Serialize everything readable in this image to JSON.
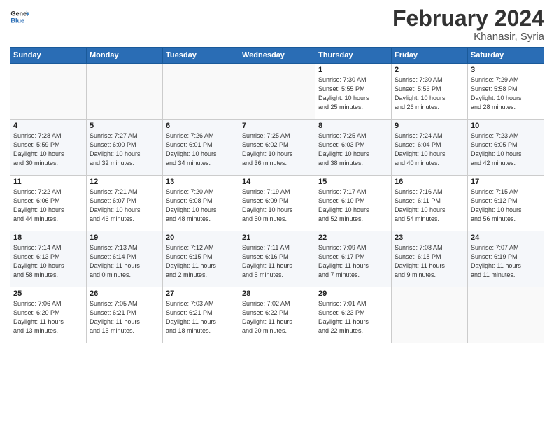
{
  "header": {
    "logo_line1": "General",
    "logo_line2": "Blue",
    "month": "February 2024",
    "location": "Khanasir, Syria"
  },
  "weekdays": [
    "Sunday",
    "Monday",
    "Tuesday",
    "Wednesday",
    "Thursday",
    "Friday",
    "Saturday"
  ],
  "weeks": [
    [
      {
        "num": "",
        "info": ""
      },
      {
        "num": "",
        "info": ""
      },
      {
        "num": "",
        "info": ""
      },
      {
        "num": "",
        "info": ""
      },
      {
        "num": "1",
        "info": "Sunrise: 7:30 AM\nSunset: 5:55 PM\nDaylight: 10 hours\nand 25 minutes."
      },
      {
        "num": "2",
        "info": "Sunrise: 7:30 AM\nSunset: 5:56 PM\nDaylight: 10 hours\nand 26 minutes."
      },
      {
        "num": "3",
        "info": "Sunrise: 7:29 AM\nSunset: 5:58 PM\nDaylight: 10 hours\nand 28 minutes."
      }
    ],
    [
      {
        "num": "4",
        "info": "Sunrise: 7:28 AM\nSunset: 5:59 PM\nDaylight: 10 hours\nand 30 minutes."
      },
      {
        "num": "5",
        "info": "Sunrise: 7:27 AM\nSunset: 6:00 PM\nDaylight: 10 hours\nand 32 minutes."
      },
      {
        "num": "6",
        "info": "Sunrise: 7:26 AM\nSunset: 6:01 PM\nDaylight: 10 hours\nand 34 minutes."
      },
      {
        "num": "7",
        "info": "Sunrise: 7:25 AM\nSunset: 6:02 PM\nDaylight: 10 hours\nand 36 minutes."
      },
      {
        "num": "8",
        "info": "Sunrise: 7:25 AM\nSunset: 6:03 PM\nDaylight: 10 hours\nand 38 minutes."
      },
      {
        "num": "9",
        "info": "Sunrise: 7:24 AM\nSunset: 6:04 PM\nDaylight: 10 hours\nand 40 minutes."
      },
      {
        "num": "10",
        "info": "Sunrise: 7:23 AM\nSunset: 6:05 PM\nDaylight: 10 hours\nand 42 minutes."
      }
    ],
    [
      {
        "num": "11",
        "info": "Sunrise: 7:22 AM\nSunset: 6:06 PM\nDaylight: 10 hours\nand 44 minutes."
      },
      {
        "num": "12",
        "info": "Sunrise: 7:21 AM\nSunset: 6:07 PM\nDaylight: 10 hours\nand 46 minutes."
      },
      {
        "num": "13",
        "info": "Sunrise: 7:20 AM\nSunset: 6:08 PM\nDaylight: 10 hours\nand 48 minutes."
      },
      {
        "num": "14",
        "info": "Sunrise: 7:19 AM\nSunset: 6:09 PM\nDaylight: 10 hours\nand 50 minutes."
      },
      {
        "num": "15",
        "info": "Sunrise: 7:17 AM\nSunset: 6:10 PM\nDaylight: 10 hours\nand 52 minutes."
      },
      {
        "num": "16",
        "info": "Sunrise: 7:16 AM\nSunset: 6:11 PM\nDaylight: 10 hours\nand 54 minutes."
      },
      {
        "num": "17",
        "info": "Sunrise: 7:15 AM\nSunset: 6:12 PM\nDaylight: 10 hours\nand 56 minutes."
      }
    ],
    [
      {
        "num": "18",
        "info": "Sunrise: 7:14 AM\nSunset: 6:13 PM\nDaylight: 10 hours\nand 58 minutes."
      },
      {
        "num": "19",
        "info": "Sunrise: 7:13 AM\nSunset: 6:14 PM\nDaylight: 11 hours\nand 0 minutes."
      },
      {
        "num": "20",
        "info": "Sunrise: 7:12 AM\nSunset: 6:15 PM\nDaylight: 11 hours\nand 2 minutes."
      },
      {
        "num": "21",
        "info": "Sunrise: 7:11 AM\nSunset: 6:16 PM\nDaylight: 11 hours\nand 5 minutes."
      },
      {
        "num": "22",
        "info": "Sunrise: 7:09 AM\nSunset: 6:17 PM\nDaylight: 11 hours\nand 7 minutes."
      },
      {
        "num": "23",
        "info": "Sunrise: 7:08 AM\nSunset: 6:18 PM\nDaylight: 11 hours\nand 9 minutes."
      },
      {
        "num": "24",
        "info": "Sunrise: 7:07 AM\nSunset: 6:19 PM\nDaylight: 11 hours\nand 11 minutes."
      }
    ],
    [
      {
        "num": "25",
        "info": "Sunrise: 7:06 AM\nSunset: 6:20 PM\nDaylight: 11 hours\nand 13 minutes."
      },
      {
        "num": "26",
        "info": "Sunrise: 7:05 AM\nSunset: 6:21 PM\nDaylight: 11 hours\nand 15 minutes."
      },
      {
        "num": "27",
        "info": "Sunrise: 7:03 AM\nSunset: 6:21 PM\nDaylight: 11 hours\nand 18 minutes."
      },
      {
        "num": "28",
        "info": "Sunrise: 7:02 AM\nSunset: 6:22 PM\nDaylight: 11 hours\nand 20 minutes."
      },
      {
        "num": "29",
        "info": "Sunrise: 7:01 AM\nSunset: 6:23 PM\nDaylight: 11 hours\nand 22 minutes."
      },
      {
        "num": "",
        "info": ""
      },
      {
        "num": "",
        "info": ""
      }
    ]
  ]
}
